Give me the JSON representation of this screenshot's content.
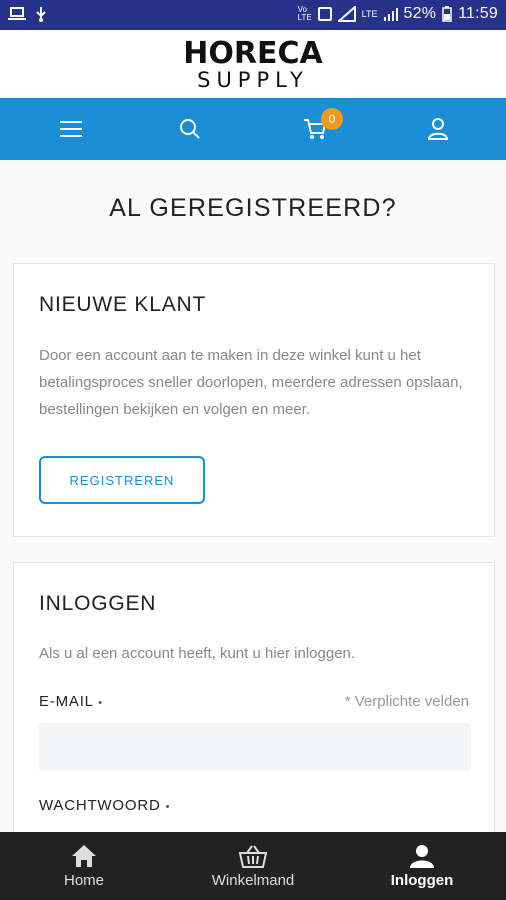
{
  "status_bar": {
    "battery": "52%",
    "time": "11:59",
    "network": "LTE"
  },
  "brand": {
    "name_top": "HORECA",
    "name_bottom": "SUPPLY"
  },
  "navbar": {
    "cart_count": "0",
    "color": "#1a8ed6",
    "badge_color": "#f39a1d"
  },
  "page": {
    "title": "AL GEREGISTREERD?"
  },
  "new_customer": {
    "title": "NIEUWE KLANT",
    "text": "Door een account aan te maken in deze winkel kunt u het betalingsproces sneller doorlopen, meerdere adressen opslaan, bestellingen bekijken en volgen en meer.",
    "button": "REGISTREREN"
  },
  "login": {
    "title": "INLOGGEN",
    "text": "Als u al een account heeft, kunt u hier inloggen.",
    "email_label": "E-MAIL",
    "required_note": "* Verplichte velden",
    "password_label": "WACHTWOORD",
    "required_mark": "•"
  },
  "tabbar": {
    "items": [
      {
        "label": "Home",
        "icon": "home-icon"
      },
      {
        "label": "Winkelmand",
        "icon": "basket-icon"
      },
      {
        "label": "Inloggen",
        "icon": "user-icon"
      }
    ]
  }
}
